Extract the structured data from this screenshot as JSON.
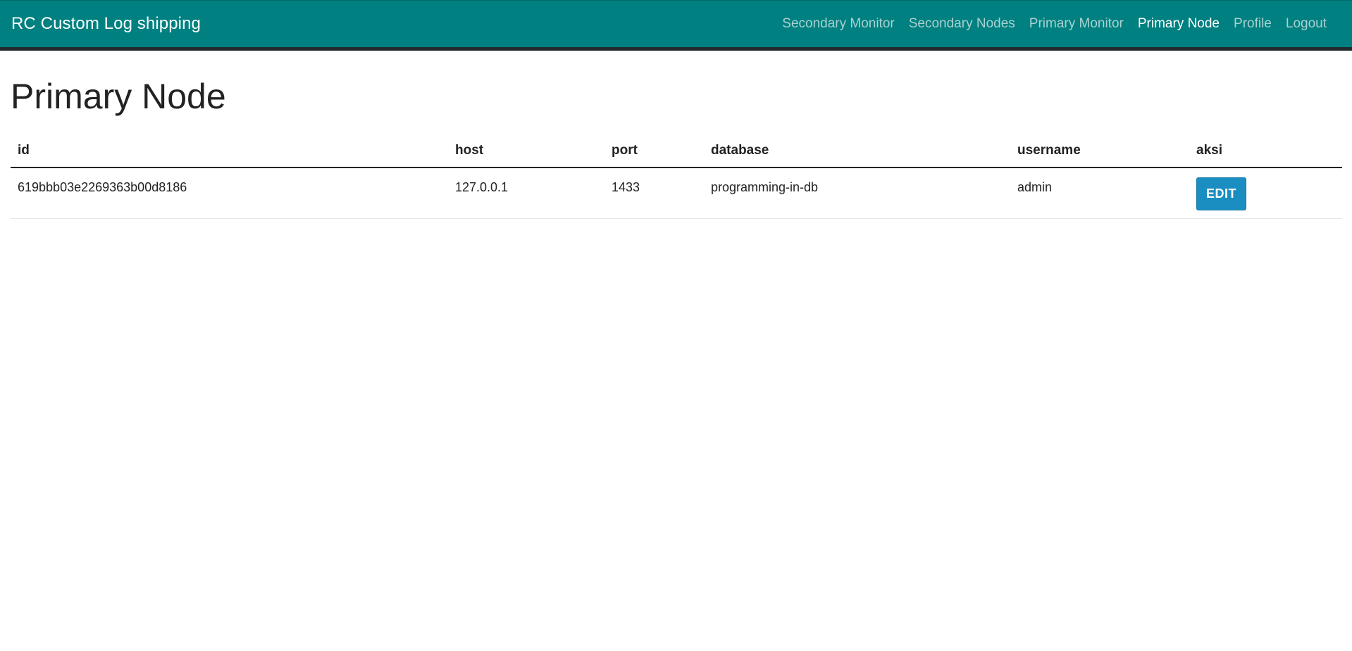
{
  "navbar": {
    "brand": "RC Custom Log shipping",
    "links": [
      {
        "label": "Secondary Monitor",
        "active": false
      },
      {
        "label": "Secondary Nodes",
        "active": false
      },
      {
        "label": "Primary Monitor",
        "active": false
      },
      {
        "label": "Primary Node",
        "active": true
      },
      {
        "label": "Profile",
        "active": false
      },
      {
        "label": "Logout",
        "active": false
      }
    ]
  },
  "page": {
    "title": "Primary Node"
  },
  "table": {
    "headers": [
      "id",
      "host",
      "port",
      "database",
      "username",
      "aksi"
    ],
    "rows": [
      {
        "id": "619bbb03e2269363b00d8186",
        "host": "127.0.0.1",
        "port": "1433",
        "database": "programming-in-db",
        "username": "admin",
        "action_label": "EDIT"
      }
    ]
  },
  "colors": {
    "navbar_bg": "#008080",
    "nav_link": "#a9d1d1",
    "nav_link_active": "#ffffff",
    "edit_button": "#1a8dc1"
  }
}
